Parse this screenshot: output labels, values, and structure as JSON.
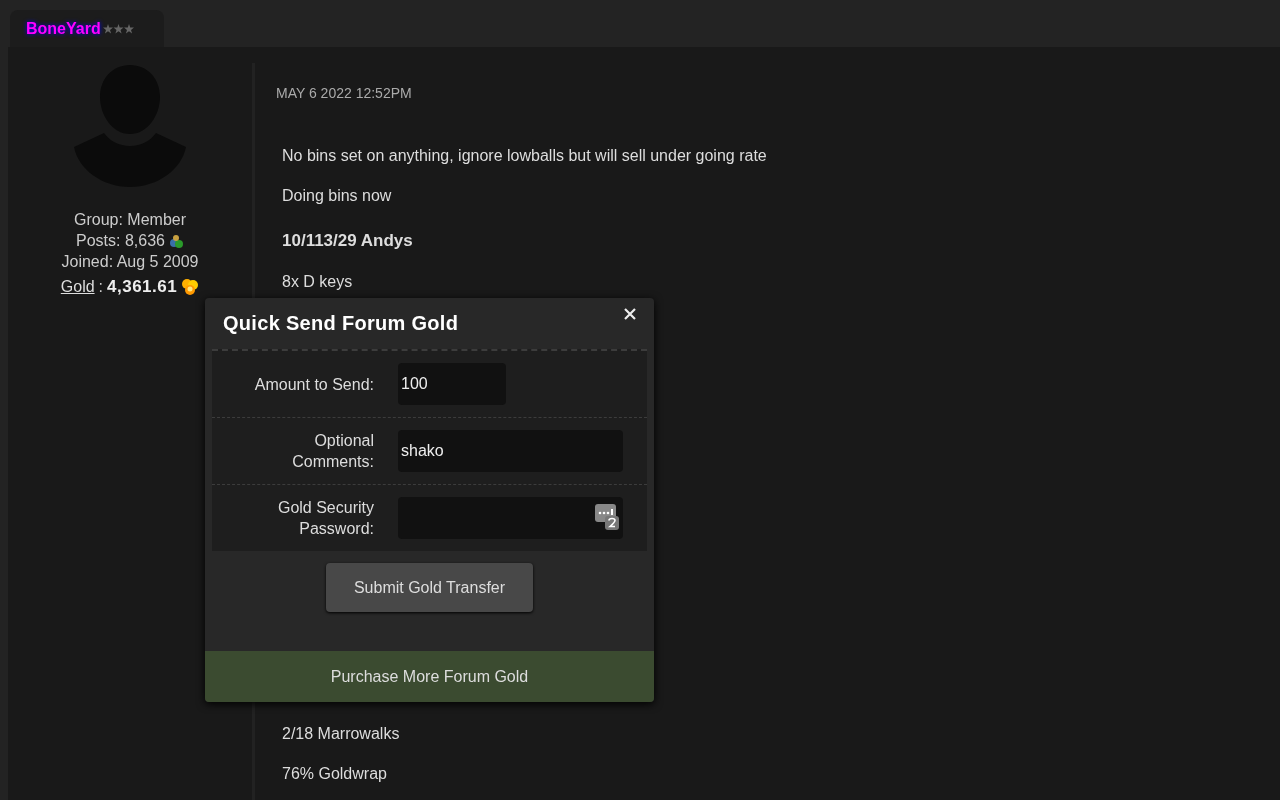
{
  "author": {
    "name": "BoneYard",
    "group": "Group: Member",
    "posts": "Posts: 8,636",
    "joined": "Joined: Aug 5 2009",
    "gold_label": "Gold",
    "gold_sep": ":",
    "gold_value": "4,361.61"
  },
  "post": {
    "date": "MAY 6 2022 12:52PM",
    "lines": [
      {
        "kind": "text",
        "text": "No bins set on anything, ignore lowballs but will sell under going rate"
      },
      {
        "kind": "text",
        "text": "Doing bins now"
      },
      {
        "kind": "heading",
        "text": "10/113/29 Andys"
      },
      {
        "kind": "text",
        "text": "8x D keys"
      },
      {
        "kind": "gap"
      },
      {
        "kind": "text",
        "text": "2/18 Marrowalks"
      },
      {
        "kind": "text",
        "text": "76% Goldwrap"
      }
    ]
  },
  "dialog": {
    "title": "Quick Send Forum Gold",
    "fields": [
      {
        "label": "Amount to Send:",
        "value": "100",
        "kind": "short"
      },
      {
        "label": "Optional Comments:",
        "value": "shako",
        "kind": "wide"
      },
      {
        "label": "Gold Security Password:",
        "kind": "password"
      }
    ],
    "submit": "Submit Gold Transfer",
    "purchase": "Purchase More Forum Gold"
  }
}
